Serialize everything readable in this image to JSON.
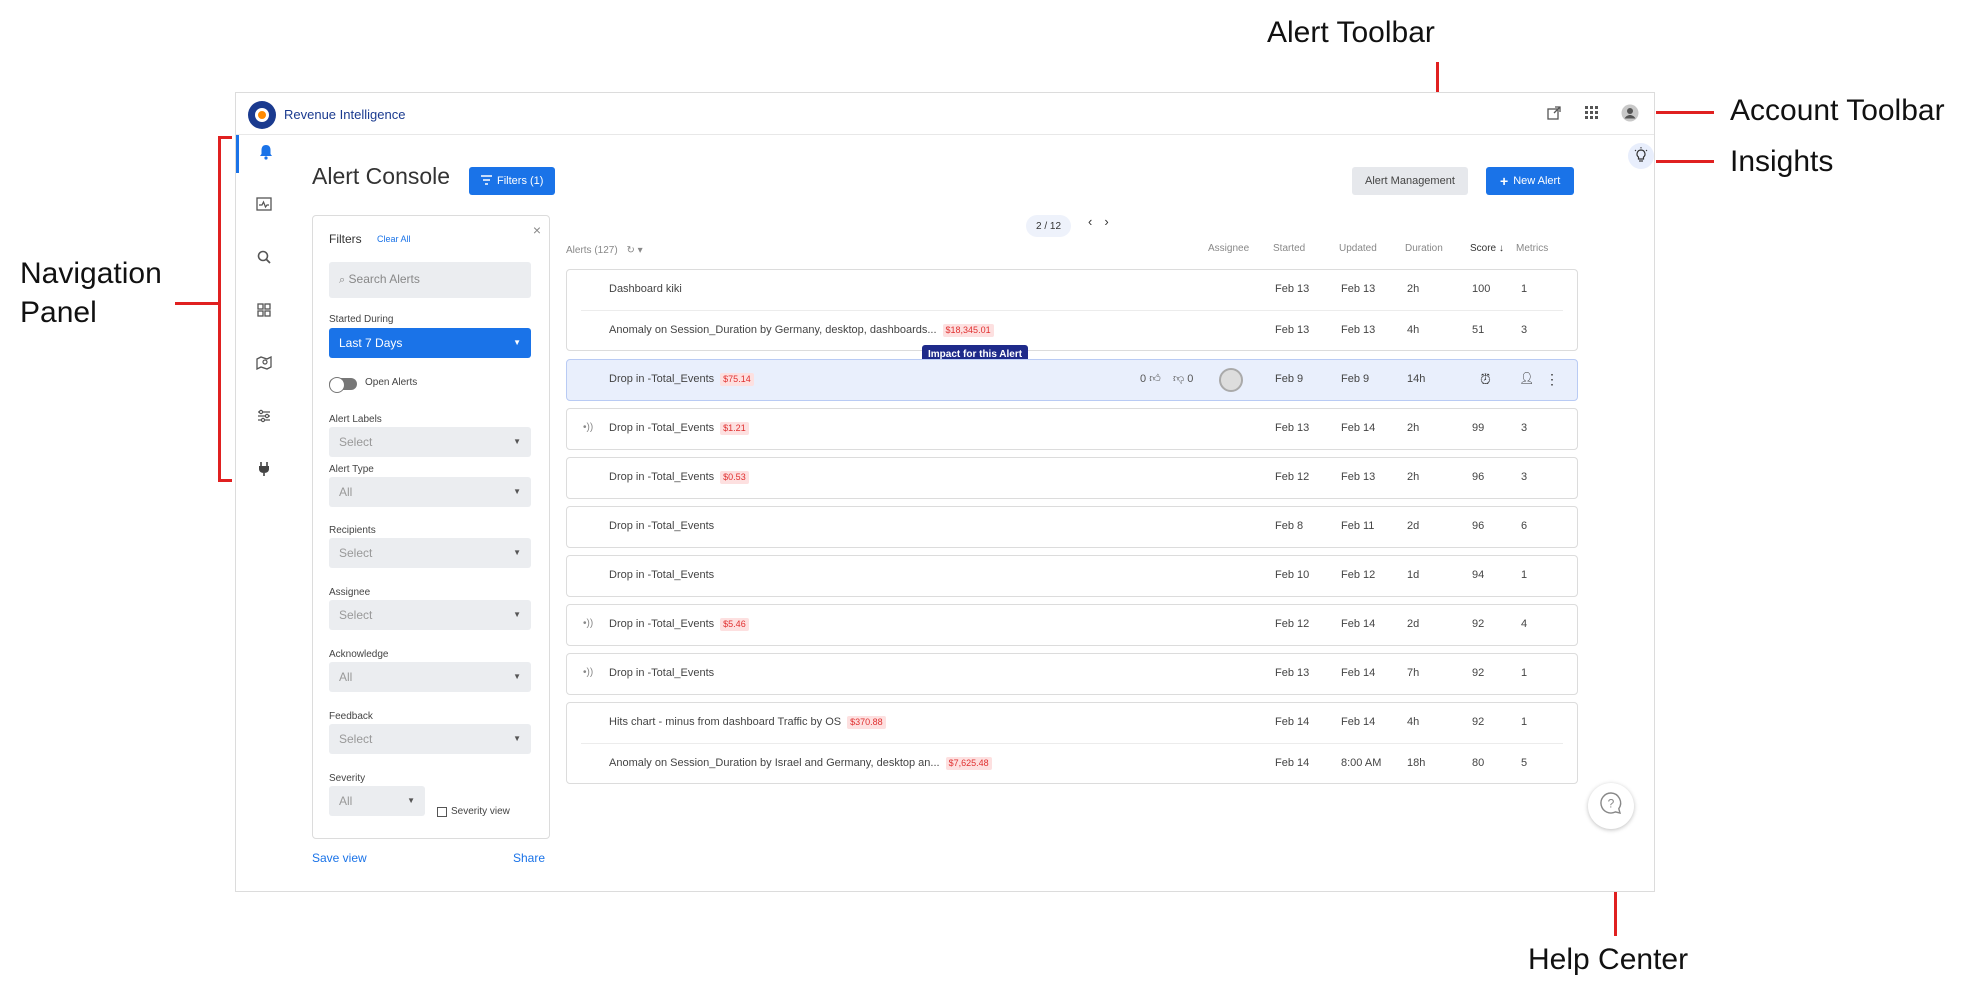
{
  "callouts": {
    "alert_toolbar": "Alert Toolbar",
    "account_toolbar": "Account Toolbar",
    "insights": "Insights",
    "navigation_panel_1": "Navigation",
    "navigation_panel_2": "Panel",
    "help_center": "Help Center"
  },
  "app": {
    "title": "Revenue Intelligence",
    "account_icons": [
      "share-icon",
      "apps-grid-icon",
      "user-avatar-icon"
    ]
  },
  "nav": {
    "items": [
      "bell-icon",
      "activity-icon",
      "search-icon",
      "dashboard-icon",
      "map-icon",
      "sliders-icon",
      "plug-icon"
    ]
  },
  "header": {
    "title": "Alert Console",
    "filters_button": "Filters (1)",
    "alert_management": "Alert Management",
    "new_alert": "New Alert"
  },
  "filters": {
    "title": "Filters",
    "clear_all": "Clear All",
    "close": "×",
    "search_placeholder": "Search Alerts",
    "started_during_label": "Started During",
    "started_during_value": "Last 7 Days",
    "open_alerts": "Open Alerts",
    "alert_labels_label": "Alert Labels",
    "alert_labels_value": "Select",
    "alert_type_label": "Alert Type",
    "alert_type_value": "All",
    "recipients_label": "Recipients",
    "recipients_value": "Select",
    "assignee_label": "Assignee",
    "assignee_value": "Select",
    "acknowledge_label": "Acknowledge",
    "acknowledge_value": "All",
    "feedback_label": "Feedback",
    "feedback_value": "Select",
    "severity_label": "Severity",
    "severity_value": "All",
    "severity_view": "Severity view",
    "save_view": "Save view",
    "share": "Share"
  },
  "list": {
    "pager": "2 / 12",
    "alerts_count": "Alerts (127)",
    "columns": {
      "assignee": "Assignee",
      "started": "Started",
      "updated": "Updated",
      "duration": "Duration",
      "score": "Score",
      "metrics": "Metrics"
    },
    "tooltip": "Impact for this Alert",
    "highlight_votes": {
      "up": "0",
      "down": "0"
    },
    "rows": [
      {
        "name": "Dashboard kiki",
        "impact": "",
        "started": "Feb 13",
        "updated": "Feb 13",
        "duration": "2h",
        "score": "100",
        "metrics": "1"
      },
      {
        "name": "Anomaly on Session_Duration by Germany, desktop, dashboards...",
        "impact": "$18,345.01",
        "started": "Feb 13",
        "updated": "Feb 13",
        "duration": "4h",
        "score": "51",
        "metrics": "3"
      },
      {
        "name": "Drop in -Total_Events",
        "impact": "$75.14",
        "started": "Feb 9",
        "updated": "Feb 9",
        "duration": "14h",
        "score": "",
        "metrics": ""
      },
      {
        "name": "Drop in -Total_Events",
        "impact": "$1.21",
        "started": "Feb 13",
        "updated": "Feb 14",
        "duration": "2h",
        "score": "99",
        "metrics": "3"
      },
      {
        "name": "Drop in -Total_Events",
        "impact": "$0.53",
        "started": "Feb 12",
        "updated": "Feb 13",
        "duration": "2h",
        "score": "96",
        "metrics": "3"
      },
      {
        "name": "Drop in -Total_Events",
        "impact": "",
        "started": "Feb 8",
        "updated": "Feb 11",
        "duration": "2d",
        "score": "96",
        "metrics": "6"
      },
      {
        "name": "Drop in -Total_Events",
        "impact": "",
        "started": "Feb 10",
        "updated": "Feb 12",
        "duration": "1d",
        "score": "94",
        "metrics": "1"
      },
      {
        "name": "Drop in -Total_Events",
        "impact": "$5.46",
        "started": "Feb 12",
        "updated": "Feb 14",
        "duration": "2d",
        "score": "92",
        "metrics": "4"
      },
      {
        "name": "Drop in -Total_Events",
        "impact": "",
        "started": "Feb 13",
        "updated": "Feb 14",
        "duration": "7h",
        "score": "92",
        "metrics": "1"
      },
      {
        "name": "Hits chart - minus from dashboard Traffic by OS",
        "impact": "$370.88",
        "started": "Feb 14",
        "updated": "Feb 14",
        "duration": "4h",
        "score": "92",
        "metrics": "1"
      },
      {
        "name": "Anomaly on Session_Duration by Israel and Germany, desktop an...",
        "impact": "$7,625.48",
        "started": "Feb 14",
        "updated": "8:00 AM",
        "duration": "18h",
        "score": "80",
        "metrics": "5"
      }
    ]
  }
}
